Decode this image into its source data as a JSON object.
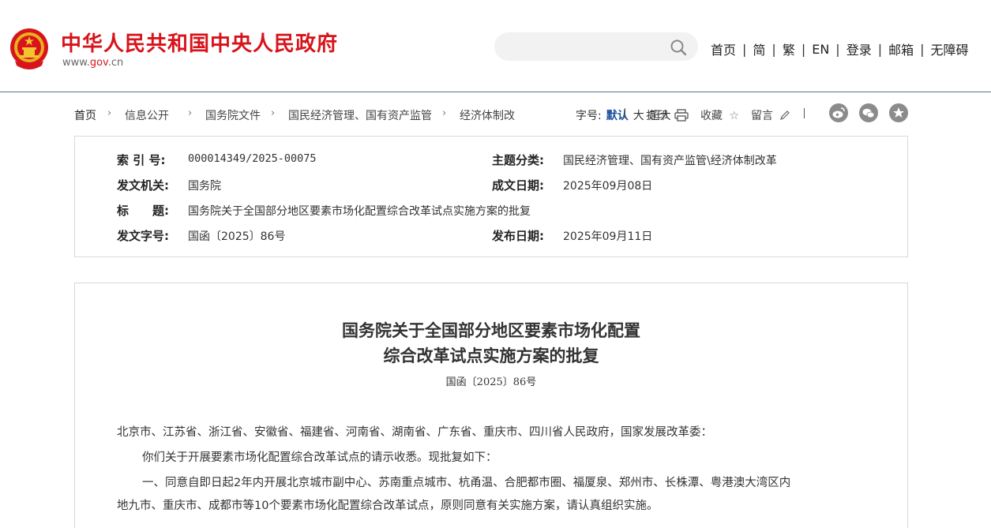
{
  "header": {
    "site_title": "中华人民共和国中央人民政府",
    "site_url_prefix": "www.",
    "site_url_brand": "gov",
    "site_url_suffix": ".cn",
    "search": {
      "value": "",
      "placeholder": ""
    },
    "nav": [
      "首页",
      "简",
      "繁",
      "EN",
      "登录",
      "邮箱",
      "无障碍"
    ]
  },
  "breadcrumb": {
    "items": [
      "首页",
      "信息公开",
      "国务院文件",
      "国民经济管理、国有资产监管",
      "经济体制改"
    ],
    "font_size_label": "字号:",
    "font_sizes": [
      "默认",
      "大",
      "超大"
    ],
    "tools": {
      "print": "打印",
      "favorite": "收藏",
      "comment": "留言"
    }
  },
  "info": {
    "index_no": {
      "label": "索 引 号:",
      "value": "000014349/2025-00075"
    },
    "category": {
      "label": "主题分类:",
      "value": "国民经济管理、国有资产监管\\经济体制改革"
    },
    "issuer": {
      "label": "发文机关:",
      "value": "国务院"
    },
    "written_date": {
      "label": "成文日期:",
      "value": "2025年09月08日"
    },
    "title": {
      "label": "标　　题:",
      "value": "国务院关于全国部分地区要素市场化配置综合改革试点实施方案的批复"
    },
    "doc_no": {
      "label": "发文字号:",
      "value": "国函〔2025〕86号"
    },
    "publish_date": {
      "label": "发布日期:",
      "value": "2025年09月11日"
    }
  },
  "article": {
    "title_line1": "国务院关于全国部分地区要素市场化配置",
    "title_line2": "综合改革试点实施方案的批复",
    "doc_no": "国函〔2025〕86号",
    "paragraphs": [
      "北京市、江苏省、浙江省、安徽省、福建省、河南省、湖南省、广东省、重庆市、四川省人民政府，国家发展改革委：",
      "你们关于开展要素市场化配置综合改革试点的请示收悉。现批复如下：",
      "一、同意自即日起2年内开展北京城市副中心、苏南重点城市、杭甬温、合肥都市圈、福厦泉、郑州市、长株潭、粤港澳大湾区内",
      "地九市、重庆市、成都市等10个要素市场化配置综合改革试点，原则同意有关实施方案，请认真组织实施。"
    ]
  },
  "colors": {
    "brand_red": "#d7141b",
    "link_blue": "#1a4f9c",
    "border": "#d9d9d9"
  }
}
